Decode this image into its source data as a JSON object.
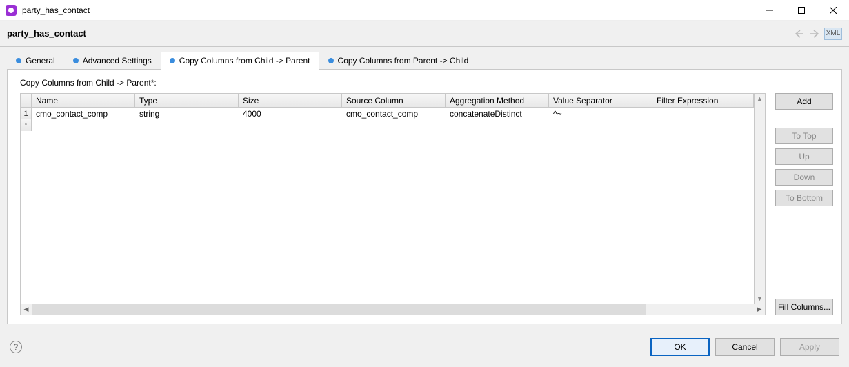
{
  "window": {
    "title": "party_has_contact"
  },
  "header": {
    "title": "party_has_contact",
    "xml_label": "XML"
  },
  "tabs": [
    {
      "id": "general",
      "label": "General",
      "active": false
    },
    {
      "id": "advanced",
      "label": "Advanced Settings",
      "active": false
    },
    {
      "id": "copy_c2p",
      "label": "Copy Columns from Child -> Parent",
      "active": true
    },
    {
      "id": "copy_p2c",
      "label": "Copy Columns from Parent -> Child",
      "active": false
    }
  ],
  "section": {
    "label": "Copy Columns from Child -> Parent*:"
  },
  "grid": {
    "columns": [
      "Name",
      "Type",
      "Size",
      "Source Column",
      "Aggregation Method",
      "Value Separator",
      "Filter Expression"
    ],
    "rows": [
      {
        "num": "1",
        "name": "cmo_contact_comp",
        "type": "string",
        "size": "4000",
        "source": "cmo_contact_comp",
        "agg": "concatenateDistinct",
        "valsep": "^~",
        "filter": ""
      }
    ],
    "newrow_marker": "*"
  },
  "side_buttons": {
    "add": "Add",
    "totop": "To Top",
    "up": "Up",
    "down": "Down",
    "tobottom": "To Bottom",
    "fill": "Fill Columns..."
  },
  "footer": {
    "ok": "OK",
    "cancel": "Cancel",
    "apply": "Apply"
  }
}
